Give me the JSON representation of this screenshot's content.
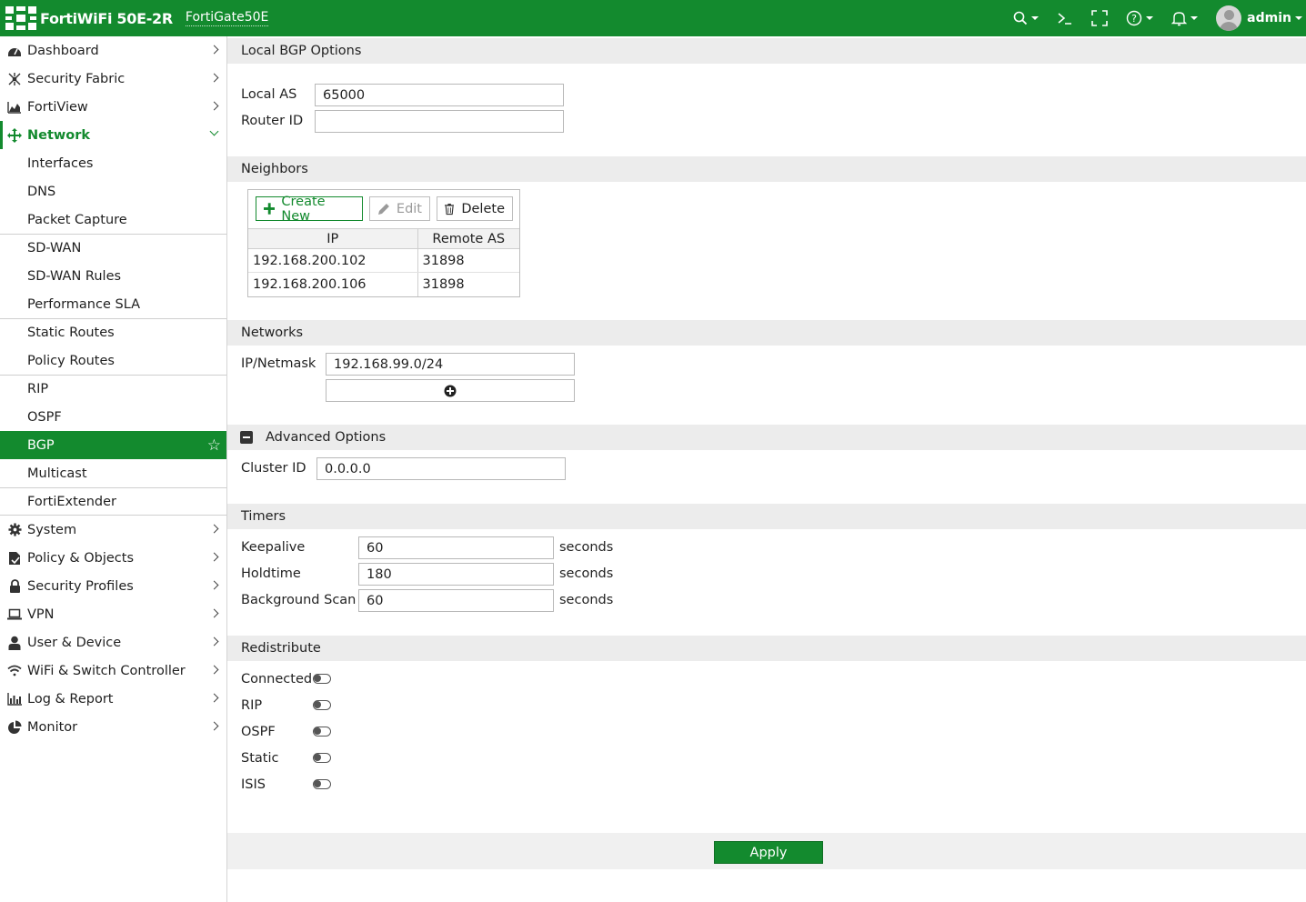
{
  "topbar": {
    "app_name": "FortiWiFi 50E-2R",
    "host_name": "FortiGate50E",
    "user": "admin",
    "icons": [
      "search-icon",
      "terminal-icon",
      "fullscreen-icon",
      "help-icon",
      "bell-icon"
    ]
  },
  "sidebar": {
    "items": [
      {
        "label": "Dashboard",
        "icon": "dashboard-icon"
      },
      {
        "label": "Security Fabric",
        "icon": "fabric-icon"
      },
      {
        "label": "FortiView",
        "icon": "chart-icon"
      },
      {
        "label": "Network",
        "icon": "network-icon"
      },
      {
        "label": "System",
        "icon": "gear-icon"
      },
      {
        "label": "Policy & Objects",
        "icon": "policy-icon"
      },
      {
        "label": "Security Profiles",
        "icon": "lock-icon"
      },
      {
        "label": "VPN",
        "icon": "laptop-icon"
      },
      {
        "label": "User & Device",
        "icon": "user-icon"
      },
      {
        "label": "WiFi & Switch Controller",
        "icon": "wifi-icon"
      },
      {
        "label": "Log & Report",
        "icon": "bar-chart-icon"
      },
      {
        "label": "Monitor",
        "icon": "pie-icon"
      }
    ],
    "network_sub": [
      "Interfaces",
      "DNS",
      "Packet Capture",
      "SD-WAN",
      "SD-WAN Rules",
      "Performance SLA",
      "Static Routes",
      "Policy Routes",
      "RIP",
      "OSPF",
      "BGP",
      "Multicast",
      "FortiExtender"
    ]
  },
  "local_bgp": {
    "header": "Local BGP Options",
    "local_as_label": "Local AS",
    "local_as_value": "65000",
    "router_id_label": "Router ID",
    "router_id_value": ""
  },
  "neighbors": {
    "header": "Neighbors",
    "create_label": "Create New",
    "edit_label": "Edit",
    "delete_label": "Delete",
    "columns": [
      "IP",
      "Remote AS"
    ],
    "rows": [
      [
        "192.168.200.102",
        "31898"
      ],
      [
        "192.168.200.106",
        "31898"
      ]
    ]
  },
  "networks": {
    "header": "Networks",
    "ip_label": "IP/Netmask",
    "ip_value": "192.168.99.0/24"
  },
  "advanced": {
    "header": "Advanced Options",
    "cluster_label": "Cluster ID",
    "cluster_value": "0.0.0.0"
  },
  "timers": {
    "header": "Timers",
    "rows": [
      {
        "label": "Keepalive",
        "value": "60",
        "unit": "seconds"
      },
      {
        "label": "Holdtime",
        "value": "180",
        "unit": "seconds"
      },
      {
        "label": "Background Scan",
        "value": "60",
        "unit": "seconds"
      }
    ]
  },
  "redistribute": {
    "header": "Redistribute",
    "items": [
      {
        "label": "Connected",
        "enabled": false
      },
      {
        "label": "RIP",
        "enabled": false
      },
      {
        "label": "OSPF",
        "enabled": false
      },
      {
        "label": "Static",
        "enabled": false
      },
      {
        "label": "ISIS",
        "enabled": false
      }
    ]
  },
  "footer": {
    "apply_label": "Apply"
  },
  "colors": {
    "brand": "#138a2e",
    "header_bg": "#ececec"
  }
}
